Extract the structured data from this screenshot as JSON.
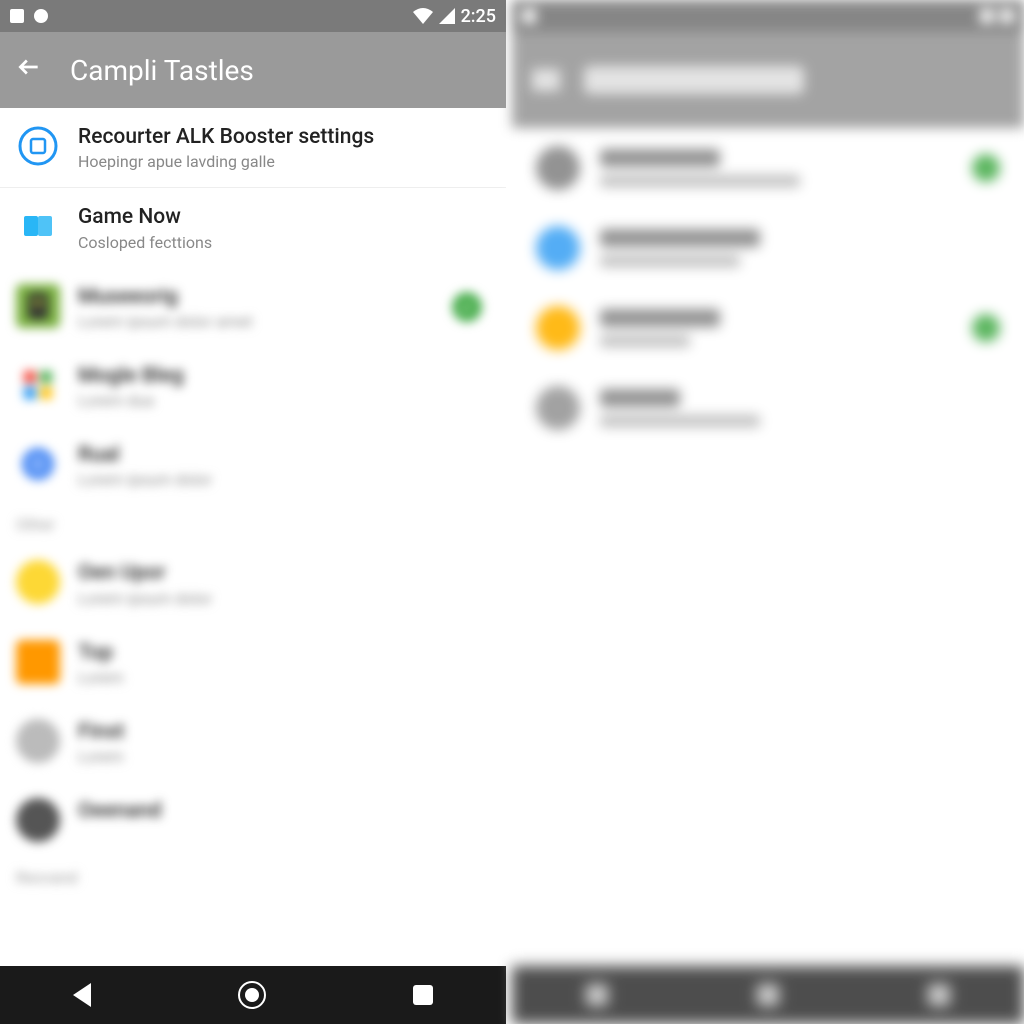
{
  "statusbar": {
    "time": "2:25"
  },
  "toolbar": {
    "title": "Campli Tastles"
  },
  "items": [
    {
      "title": "Recourter ALK Booster settings",
      "sub": "Hoepingr apue lavding galle"
    },
    {
      "title": "Game Now",
      "sub": "Cosloped fecttions"
    },
    {
      "title": "Museeorig",
      "sub": ""
    },
    {
      "title": "Mogle Bleg",
      "sub": ""
    },
    {
      "title": "Rual",
      "sub": ""
    }
  ],
  "section": "Other",
  "blur_items": [
    {
      "title": "Oen Upor",
      "sub": ""
    },
    {
      "title": "Top",
      "sub": ""
    },
    {
      "title": "Finst",
      "sub": ""
    },
    {
      "title": "Oeenand",
      "sub": ""
    }
  ]
}
